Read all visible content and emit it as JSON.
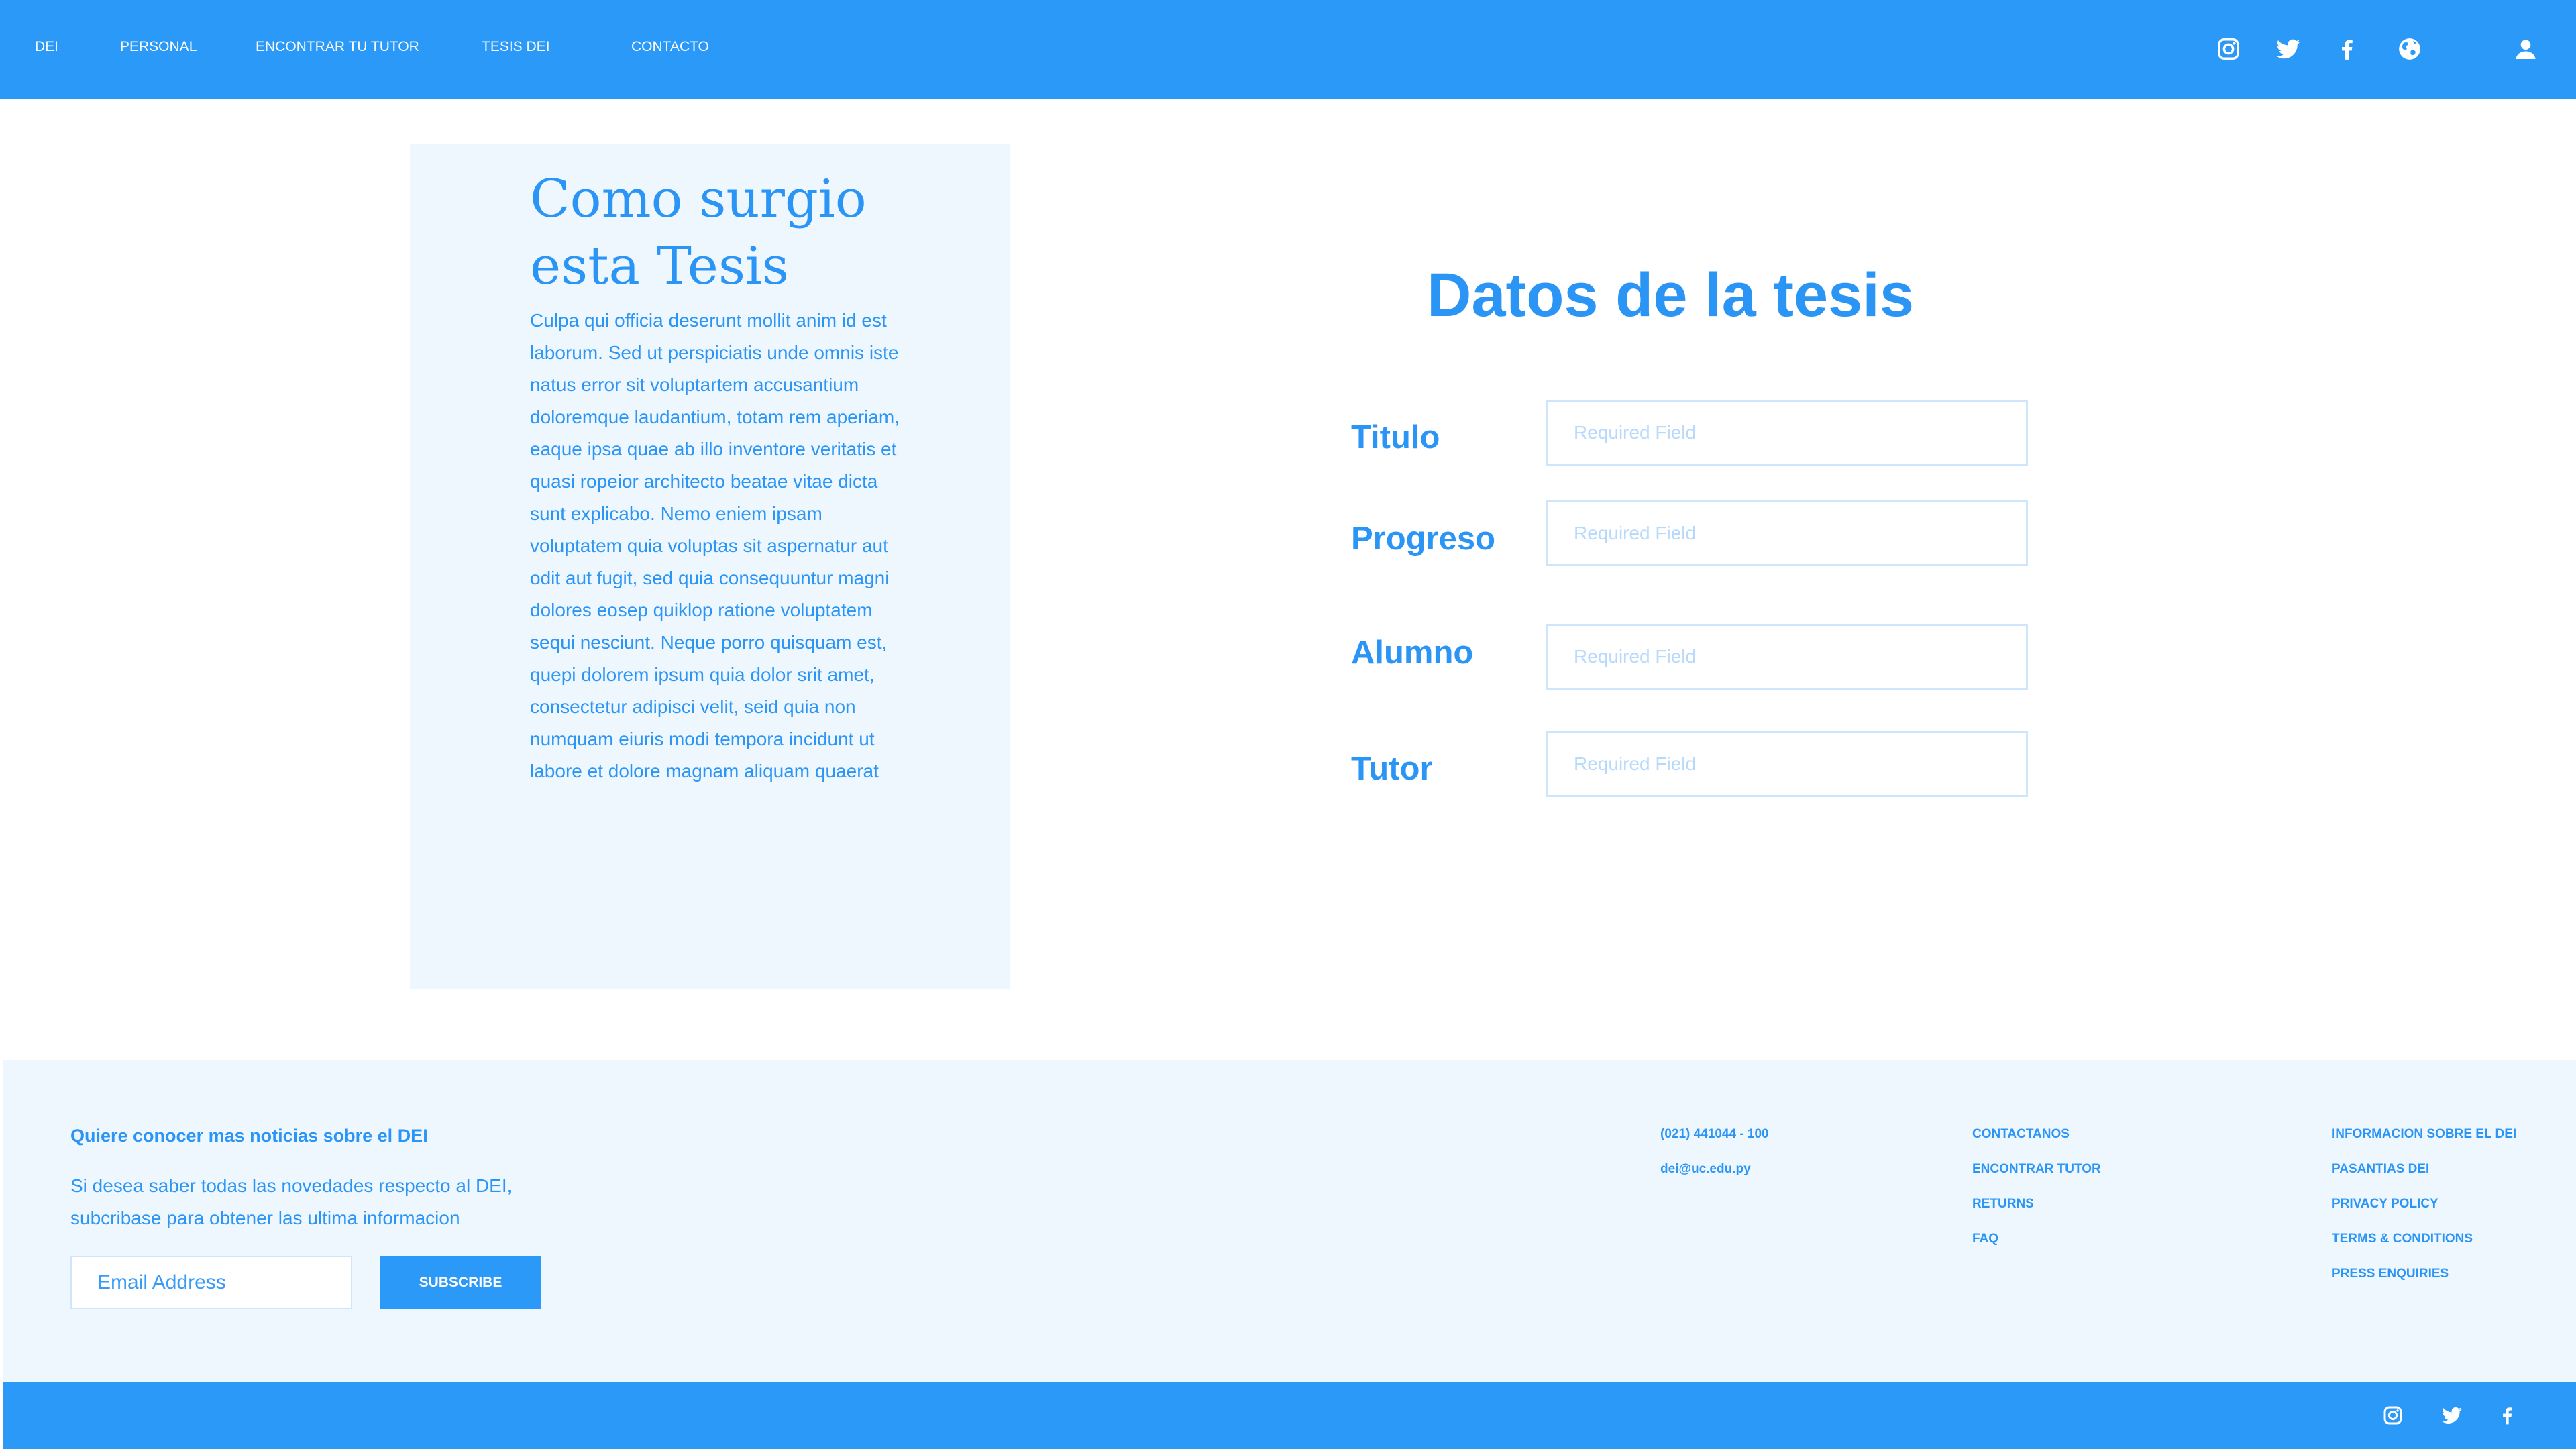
{
  "nav": {
    "links": [
      "DEI",
      "PERSONAL",
      "ENCONTRAR TU TUTOR",
      "TESIS DEI",
      "CONTACTO"
    ],
    "icons": [
      "instagram-icon",
      "twitter-icon",
      "facebook-icon",
      "globe-icon",
      "user-icon"
    ]
  },
  "story": {
    "title": "Como surgio esta Tesis",
    "body": "Culpa qui officia deserunt mollit anim id est laborum. Sed ut perspiciatis unde omnis iste natus error sit voluptartem accusantium doloremque laudantium, totam rem aperiam, eaque ipsa quae ab illo inventore veritatis et quasi ropeior architecto beatae vitae dicta sunt explicabo. Nemo eniem ipsam voluptatem quia voluptas sit aspernatur aut odit aut fugit, sed quia consequuntur magni dolores eosep quiklop ratione voluptatem sequi nesciunt. Neque porro quisquam est, quepi dolorem ipsum quia dolor srit amet, consectetur adipisci velit, seid quia non numquam eiuris modi tempora incidunt ut labore et dolore magnam aliquam quaerat"
  },
  "form": {
    "title": "Datos de la tesis",
    "fields": [
      {
        "label": "Titulo",
        "value": "",
        "placeholder": "Required Field"
      },
      {
        "label": "Progreso",
        "value": "",
        "placeholder": "Required Field"
      },
      {
        "label": "Alumno",
        "value": "",
        "placeholder": "Required Field"
      },
      {
        "label": "Tutor",
        "value": "",
        "placeholder": "Required Field"
      }
    ]
  },
  "footer": {
    "newsletter_title": "Quiere conocer mas noticias sobre el DEI",
    "newsletter_text": "Si desea saber todas las novedades respecto al DEI, subcribase para obtener las ultima informacion",
    "email_placeholder": "Email Address",
    "subscribe_label": "SUBSCRIBE",
    "contact": [
      "(021) 441044 - 100",
      "dei@uc.edu.py"
    ],
    "links_col1": [
      "CONTACTANOS",
      "ENCONTRAR TUTOR",
      "RETURNS",
      "FAQ"
    ],
    "links_col2": [
      "INFORMACION SOBRE EL DEI",
      "PASANTIAS DEI",
      "PRIVACY POLICY",
      "TERMS & CONDITIONS",
      "PRESS ENQUIRIES"
    ]
  },
  "bottom_bar": {
    "icons": [
      "instagram-icon",
      "twitter-icon",
      "facebook-icon"
    ]
  },
  "colors": {
    "primary": "#2b99f8",
    "panel_bg": "#eff7fe",
    "placeholder": "#b7d9fb"
  }
}
